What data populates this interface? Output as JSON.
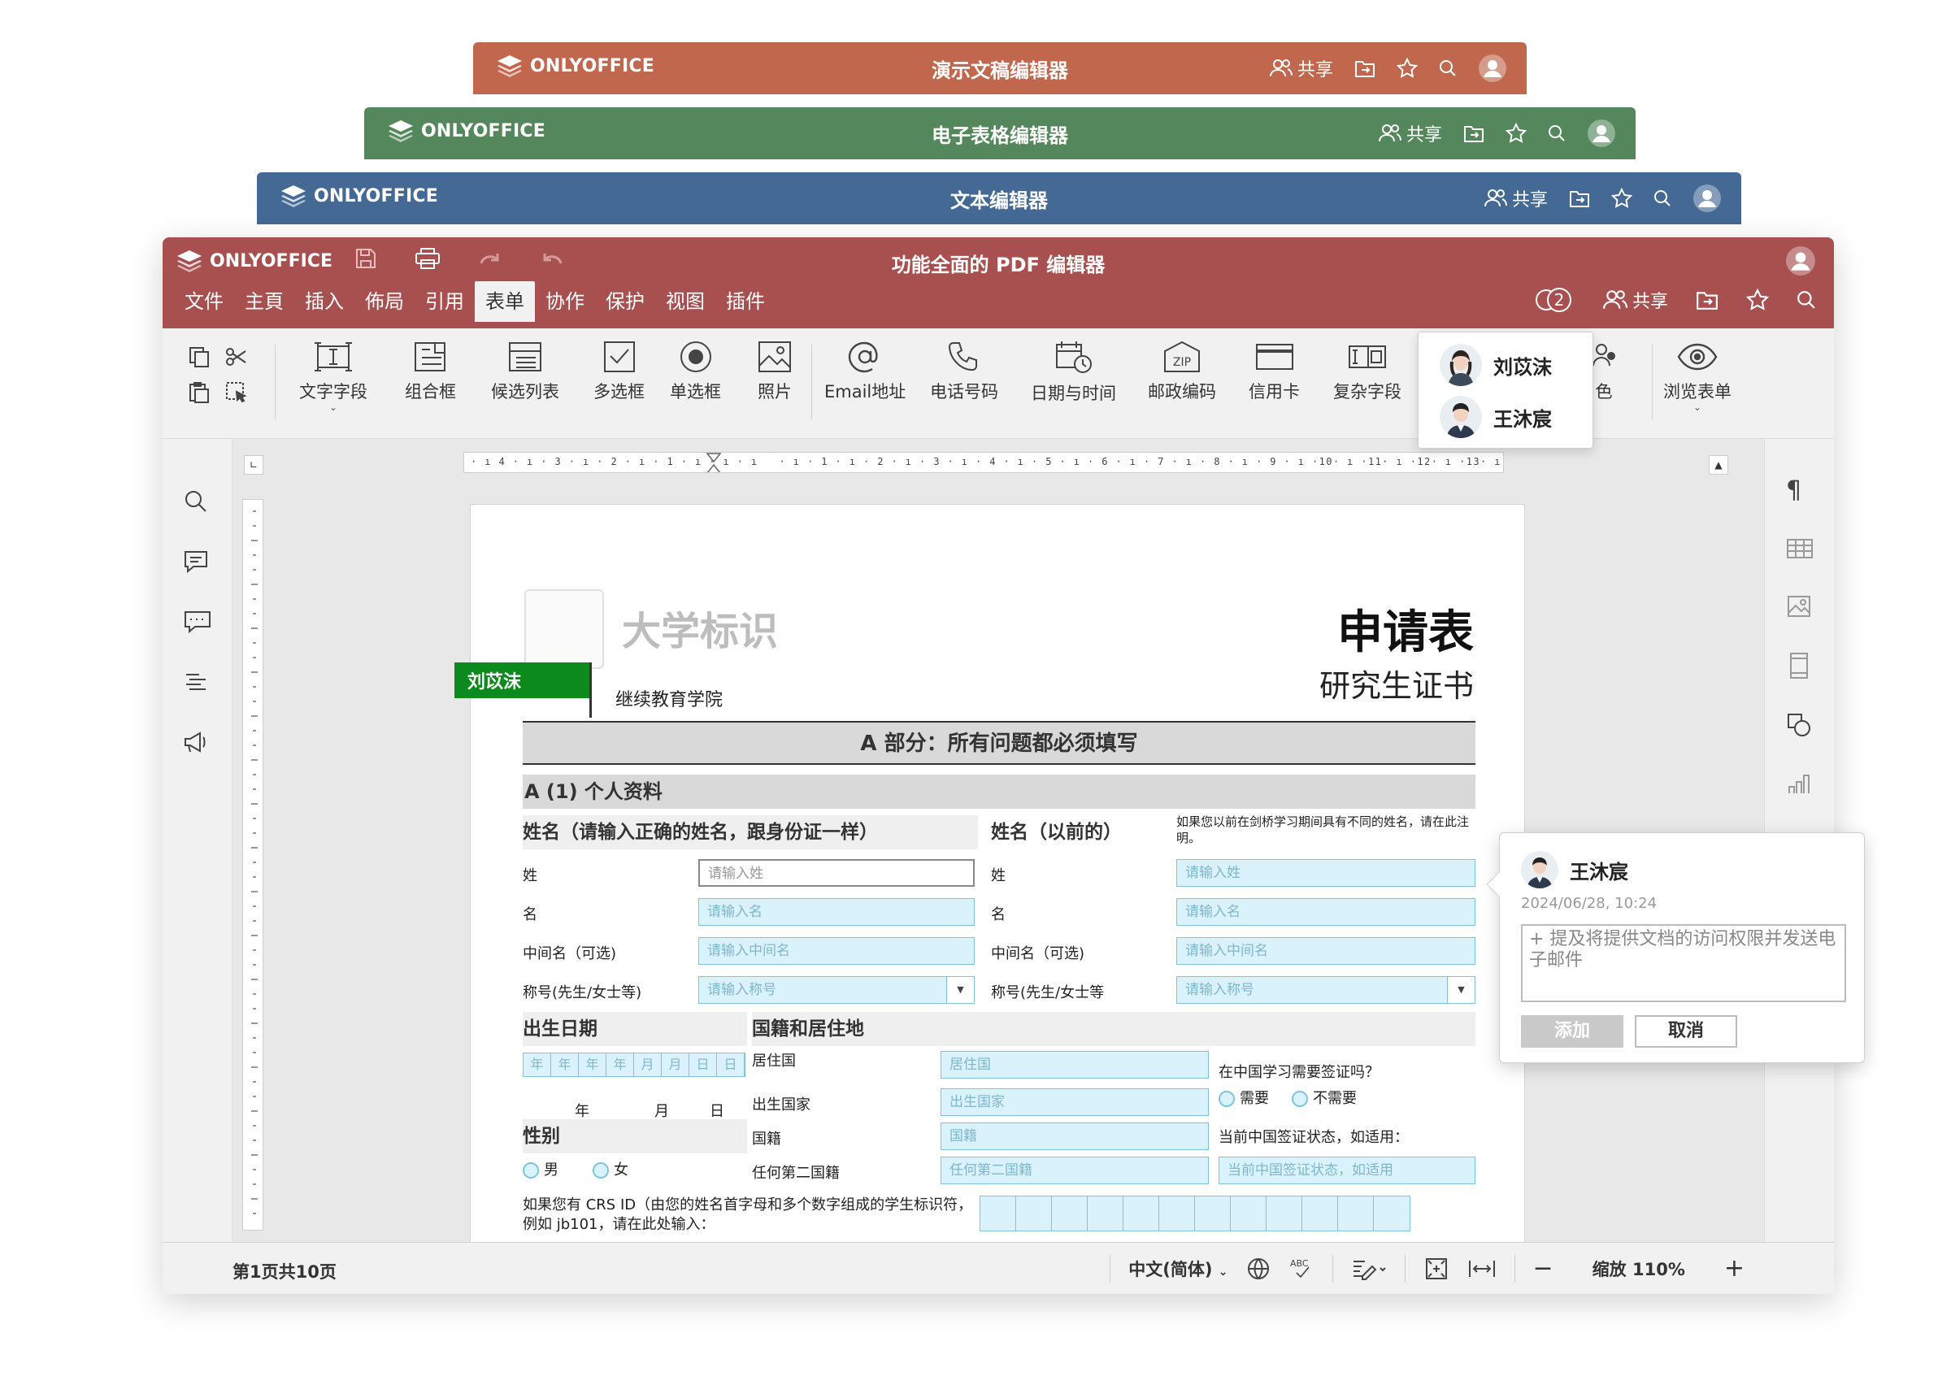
{
  "brand": "ONLYOFFICE",
  "colors": {
    "presentation": "#c0674d",
    "spreadsheet": "#54875b",
    "document": "#446995",
    "pdf": "#a84f4f",
    "field_fill": "#d9f2fb",
    "author_tag": "#0d8a1d"
  },
  "stack": {
    "presentation_title": "演示文稿编辑器",
    "spreadsheet_title": "电子表格编辑器",
    "document_title": "文本编辑器",
    "share_label": "共享"
  },
  "header": {
    "title": "功能全面的 PDF 编辑器",
    "share_label": "共享",
    "coauthor_count": "2"
  },
  "menu_tabs": [
    "文件",
    "主頁",
    "插入",
    "佈局",
    "引用",
    "表单",
    "协作",
    "保护",
    "视图",
    "插件"
  ],
  "toolbar": {
    "text_field": "文字字段",
    "combo_box": "组合框",
    "dropdown": "候选列表",
    "checkbox": "多选框",
    "radio": "单选框",
    "image": "照片",
    "email": "Email地址",
    "phone": "电话号码",
    "datetime": "日期与时间",
    "zip": "邮政编码",
    "credit_card": "信用卡",
    "complex": "复杂字段",
    "roles": "色",
    "view_form": "浏览表单"
  },
  "users_popup": [
    "刘苡沫",
    "王沐宸"
  ],
  "form": {
    "university_mark": "大学标识",
    "college": "继续教育学院",
    "title": "申请表",
    "subtitle": "研究生证书",
    "author_tag": "刘苡沫",
    "section_a": "A 部分：所有问题都必须填写",
    "personal": "A (1) 个人资料",
    "name_head": "姓名（请输入正确的姓名，跟身份证一样）",
    "prev_name_head": "姓名（以前的）",
    "prev_name_note": "如果您以前在剑桥学习期间具有不同的姓名，请在此注明。",
    "surname": "姓",
    "given": "名",
    "middle": "中间名（可选)",
    "titlel": "称号(先生/女士等)",
    "titlel2": "称号(先生/女士等",
    "ph_surname": "请输入姓",
    "ph_given": "请输入名",
    "ph_middle": "请输入中间名",
    "ph_title": "请输入称号",
    "dob_head": "出生日期",
    "nationality_head": "国籍和居住地",
    "date_cells": [
      "年",
      "年",
      "年",
      "年",
      "月",
      "月",
      "日",
      "日"
    ],
    "date_year": "年",
    "date_month": "月",
    "date_day": "日",
    "residence": "居住国",
    "birth_country": "出生国家",
    "nationality": "国籍",
    "second_nationality": "任何第二国籍",
    "ph_residence": "居住国",
    "ph_birth_country": "出生国家",
    "ph_nationality": "国籍",
    "ph_second_nationality": "任何第二国籍",
    "visa_q": "在中国学习需要签证吗？",
    "visa_yes": "需要",
    "visa_no": "不需要",
    "visa_status": "当前中国签证状态，如适用：",
    "ph_visa_status": "当前中国签证状态，如适用",
    "gender_head": "性别",
    "male": "男",
    "female": "女",
    "crs_note": "如果您有 CRS ID（由您的姓名首字母和多个数字组成的学生标识符，例如 jb101，请在此处输入："
  },
  "ruler_marks": "· ı 4 · ı · 3 · ı · 2 · ı · 1 · ı · ı · ı   · ı · 1 · ı · 2 · ı · 3 · ı · 4 · ı · 5 · ı · 6 · ı · 7 · ı · 8 · ı · 9 · ı ·10· ı ·11· ı ·12· ı ·13· ı ·14· ı ·15· ı ·",
  "comment": {
    "author": "王沐宸",
    "time": "2024/06/28,  10:24",
    "text": "+ 提及将提供文档的访问权限并发送电子邮件",
    "add": "添加",
    "cancel": "取消"
  },
  "status": {
    "page": "第1页共10页",
    "language": "中文(简体)",
    "zoom": "缩放 110%"
  }
}
